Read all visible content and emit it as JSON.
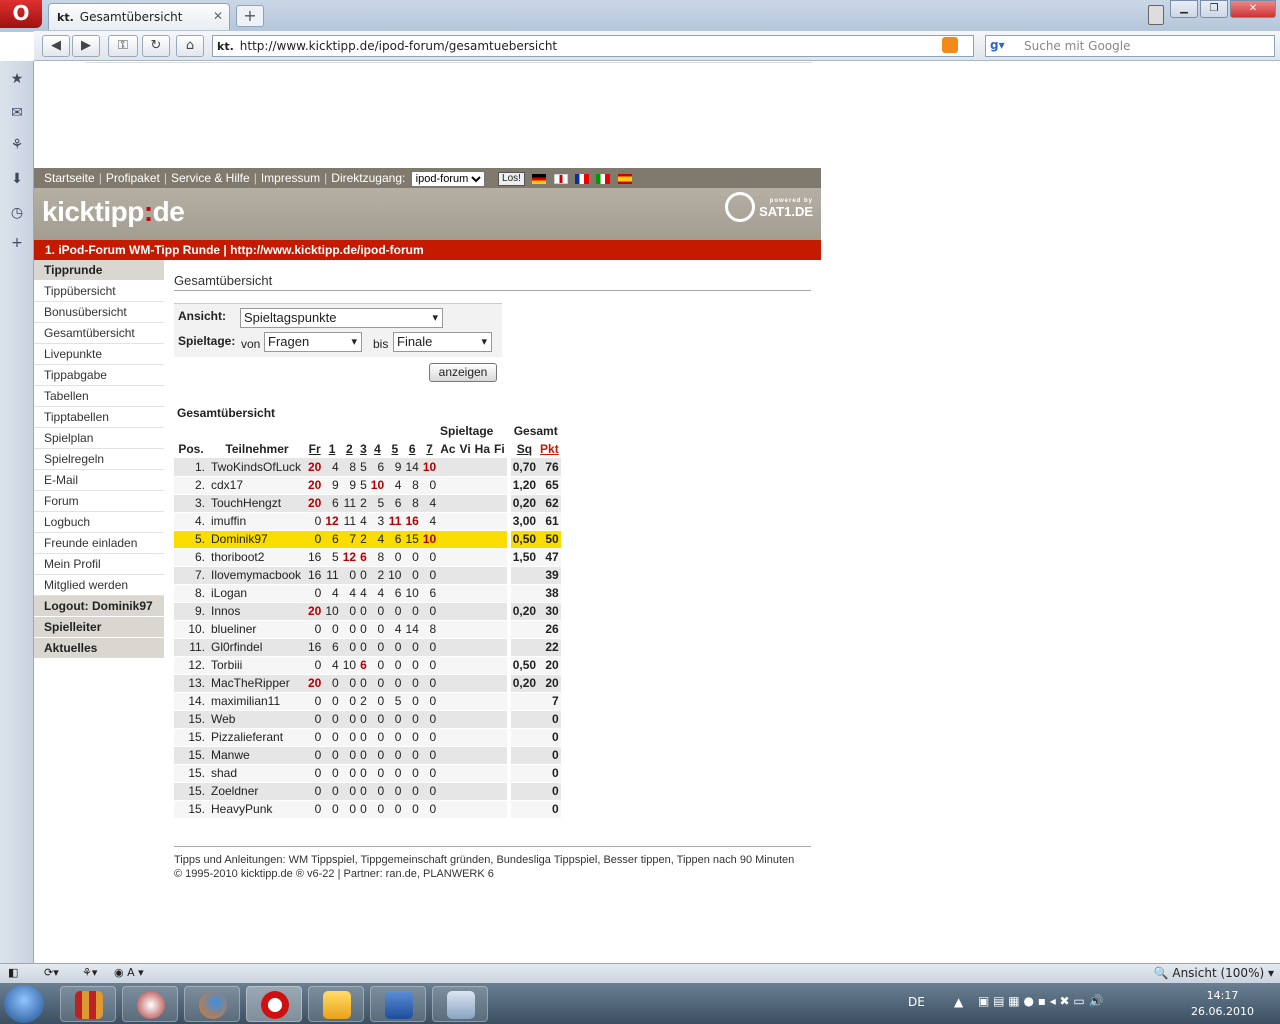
{
  "browser": {
    "tab_title": "Gesamtübersicht",
    "tab_favicon": "kt.",
    "url": "http://www.kicktipp.de/ipod-forum/gesamtuebersicht",
    "search_placeholder": "Suche mit Google",
    "zoom_label": "Ansicht (100%)"
  },
  "taskbar": {
    "lang": "DE",
    "time": "14:17",
    "date": "26.06.2010"
  },
  "site": {
    "topnav": [
      "Startseite",
      "Profipaket",
      "Service & Hilfe",
      "Impressum"
    ],
    "direct_label": "Direktzugang:",
    "direct_value": "ipod-forum",
    "go_button": "Los!",
    "logo": "kicktipp.de",
    "powered_by": "powered by",
    "sponsor": "SAT1.DE",
    "round_title": "1. iPod-Forum WM-Tipp Runde | http://www.kicktipp.de/ipod-forum"
  },
  "nav": {
    "sections": [
      {
        "label": "Tipprunde",
        "header": true
      },
      {
        "label": "Tippübersicht"
      },
      {
        "label": "Bonusübersicht"
      },
      {
        "label": "Gesamtübersicht"
      },
      {
        "label": "Livepunkte"
      },
      {
        "label": "Tippabgabe"
      },
      {
        "label": "Tabellen"
      },
      {
        "label": "Tipptabellen"
      },
      {
        "label": "Spielplan"
      },
      {
        "label": "Spielregeln"
      },
      {
        "label": "E-Mail"
      },
      {
        "label": "Forum"
      },
      {
        "label": "Logbuch"
      },
      {
        "label": "Freunde einladen"
      },
      {
        "label": "Mein Profil"
      },
      {
        "label": "Mitglied werden"
      },
      {
        "label": "Logout: Dominik97",
        "header": true
      },
      {
        "label": "Spielleiter",
        "header": true
      },
      {
        "label": "Aktuelles",
        "header": true
      }
    ]
  },
  "main": {
    "title": "Gesamtübersicht",
    "filter": {
      "view_label": "Ansicht:",
      "view_value": "Spieltagspunkte",
      "days_label": "Spieltage:",
      "from_label": "von",
      "from_value": "Fragen",
      "to_label": "bis",
      "to_value": "Finale",
      "submit": "anzeigen"
    },
    "table_caption": "Gesamtübersicht",
    "group_days": "Spieltage",
    "group_total": "Gesamt",
    "col_pos": "Pos.",
    "col_name": "Teilnehmer",
    "day_cols": [
      "Fr",
      "1",
      "2",
      "3",
      "4",
      "5",
      "6",
      "7",
      "Ac",
      "Vi",
      "Ha",
      "Fi"
    ],
    "col_sq": "Sq",
    "col_pkt": "Pkt",
    "rows": [
      {
        "pos": "1.",
        "name": "TwoKindsOfLuck",
        "days": [
          "20",
          "4",
          "8",
          "5",
          "6",
          "9",
          "14",
          "10",
          "",
          "",
          "",
          ""
        ],
        "hi": [
          0,
          7
        ],
        "sq": "0,70",
        "pkt": "76"
      },
      {
        "pos": "2.",
        "name": "cdx17",
        "days": [
          "20",
          "9",
          "9",
          "5",
          "10",
          "4",
          "8",
          "0",
          "",
          "",
          "",
          ""
        ],
        "hi": [
          0,
          4
        ],
        "sq": "1,20",
        "pkt": "65"
      },
      {
        "pos": "3.",
        "name": "TouchHengzt",
        "days": [
          "20",
          "6",
          "11",
          "2",
          "5",
          "6",
          "8",
          "4",
          "",
          "",
          "",
          ""
        ],
        "hi": [
          0
        ],
        "sq": "0,20",
        "pkt": "62"
      },
      {
        "pos": "4.",
        "name": "imuffin",
        "days": [
          "0",
          "12",
          "11",
          "4",
          "3",
          "11",
          "16",
          "4",
          "",
          "",
          "",
          ""
        ],
        "hi": [
          1,
          5,
          6
        ],
        "sq": "3,00",
        "pkt": "61"
      },
      {
        "pos": "5.",
        "name": "Dominik97",
        "days": [
          "0",
          "6",
          "7",
          "2",
          "4",
          "6",
          "15",
          "10",
          "",
          "",
          "",
          ""
        ],
        "hi": [
          7
        ],
        "sq": "0,50",
        "pkt": "50",
        "me": true
      },
      {
        "pos": "6.",
        "name": "thoriboot2",
        "days": [
          "16",
          "5",
          "12",
          "6",
          "8",
          "0",
          "0",
          "0",
          "",
          "",
          "",
          ""
        ],
        "hi": [
          2,
          3
        ],
        "sq": "1,50",
        "pkt": "47"
      },
      {
        "pos": "7.",
        "name": "Ilovemymacbook",
        "days": [
          "16",
          "11",
          "0",
          "0",
          "2",
          "10",
          "0",
          "0",
          "",
          "",
          "",
          ""
        ],
        "hi": [],
        "sq": "",
        "pkt": "39"
      },
      {
        "pos": "8.",
        "name": "iLogan",
        "days": [
          "0",
          "4",
          "4",
          "4",
          "4",
          "6",
          "10",
          "6",
          "",
          "",
          "",
          ""
        ],
        "hi": [],
        "sq": "",
        "pkt": "38"
      },
      {
        "pos": "9.",
        "name": "Innos",
        "days": [
          "20",
          "10",
          "0",
          "0",
          "0",
          "0",
          "0",
          "0",
          "",
          "",
          "",
          ""
        ],
        "hi": [
          0
        ],
        "sq": "0,20",
        "pkt": "30"
      },
      {
        "pos": "10.",
        "name": "blueliner",
        "days": [
          "0",
          "0",
          "0",
          "0",
          "0",
          "4",
          "14",
          "8",
          "",
          "",
          "",
          ""
        ],
        "hi": [],
        "sq": "",
        "pkt": "26"
      },
      {
        "pos": "11.",
        "name": "Gl0rfindel",
        "days": [
          "16",
          "6",
          "0",
          "0",
          "0",
          "0",
          "0",
          "0",
          "",
          "",
          "",
          ""
        ],
        "hi": [],
        "sq": "",
        "pkt": "22"
      },
      {
        "pos": "12.",
        "name": "Torbiii",
        "days": [
          "0",
          "4",
          "10",
          "6",
          "0",
          "0",
          "0",
          "0",
          "",
          "",
          "",
          ""
        ],
        "hi": [
          3
        ],
        "sq": "0,50",
        "pkt": "20"
      },
      {
        "pos": "13.",
        "name": "MacTheRipper",
        "days": [
          "20",
          "0",
          "0",
          "0",
          "0",
          "0",
          "0",
          "0",
          "",
          "",
          "",
          ""
        ],
        "hi": [
          0
        ],
        "sq": "0,20",
        "pkt": "20"
      },
      {
        "pos": "14.",
        "name": "maximilian11",
        "days": [
          "0",
          "0",
          "0",
          "2",
          "0",
          "5",
          "0",
          "0",
          "",
          "",
          "",
          ""
        ],
        "hi": [],
        "sq": "",
        "pkt": "7"
      },
      {
        "pos": "15.",
        "name": "Web",
        "days": [
          "0",
          "0",
          "0",
          "0",
          "0",
          "0",
          "0",
          "0",
          "",
          "",
          "",
          ""
        ],
        "hi": [],
        "sq": "",
        "pkt": "0"
      },
      {
        "pos": "15.",
        "name": "Pizzalieferant",
        "days": [
          "0",
          "0",
          "0",
          "0",
          "0",
          "0",
          "0",
          "0",
          "",
          "",
          "",
          ""
        ],
        "hi": [],
        "sq": "",
        "pkt": "0"
      },
      {
        "pos": "15.",
        "name": "Manwe",
        "days": [
          "0",
          "0",
          "0",
          "0",
          "0",
          "0",
          "0",
          "0",
          "",
          "",
          "",
          ""
        ],
        "hi": [],
        "sq": "",
        "pkt": "0"
      },
      {
        "pos": "15.",
        "name": "shad",
        "days": [
          "0",
          "0",
          "0",
          "0",
          "0",
          "0",
          "0",
          "0",
          "",
          "",
          "",
          ""
        ],
        "hi": [],
        "sq": "",
        "pkt": "0"
      },
      {
        "pos": "15.",
        "name": "Zoeldner",
        "days": [
          "0",
          "0",
          "0",
          "0",
          "0",
          "0",
          "0",
          "0",
          "",
          "",
          "",
          ""
        ],
        "hi": [],
        "sq": "",
        "pkt": "0"
      },
      {
        "pos": "15.",
        "name": "HeavyPunk",
        "days": [
          "0",
          "0",
          "0",
          "0",
          "0",
          "0",
          "0",
          "0",
          "",
          "",
          "",
          ""
        ],
        "hi": [],
        "sq": "",
        "pkt": "0"
      }
    ]
  },
  "footer": {
    "line1": "Tipps und Anleitungen: WM Tippspiel, Tippgemeinschaft gründen, Bundesliga Tippspiel, Besser tippen, Tippen nach 90 Minuten",
    "line2": "© 1995-2010 kicktipp.de ® v6-22 | Partner: ran.de, PLANWERK 6"
  }
}
